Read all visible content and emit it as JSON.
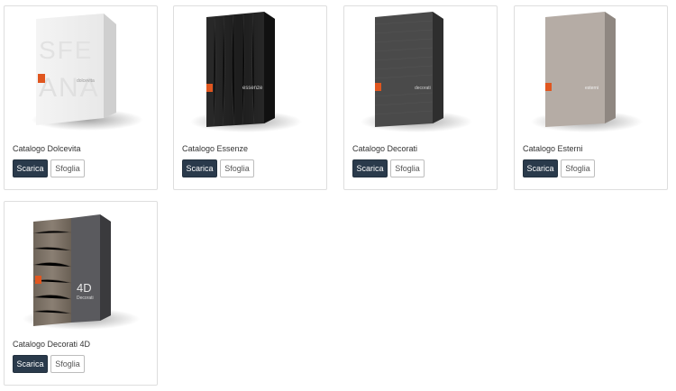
{
  "catalogs": [
    {
      "title": "Catalogo Dolcevita",
      "download_label": "Scarica",
      "browse_label": "Sfoglia",
      "cover_style": "white",
      "cover_text": "SFE ANA",
      "brand_mark": "dolcevita"
    },
    {
      "title": "Catalogo Essenze",
      "download_label": "Scarica",
      "browse_label": "Sfoglia",
      "cover_style": "dark-wood",
      "cover_text": "essenze",
      "brand_mark": "essenze"
    },
    {
      "title": "Catalogo Decorati",
      "download_label": "Scarica",
      "browse_label": "Sfoglia",
      "cover_style": "dark-grey",
      "cover_text": "decorati",
      "brand_mark": "decorati"
    },
    {
      "title": "Catalogo Esterni",
      "download_label": "Scarica",
      "browse_label": "Sfoglia",
      "cover_style": "taupe",
      "cover_text": "esterni",
      "brand_mark": "esterni"
    },
    {
      "title": "Catalogo Decorati 4D",
      "download_label": "Scarica",
      "browse_label": "Sfoglia",
      "cover_style": "wood-4d",
      "cover_text": "4D Decorati",
      "brand_mark": "4d"
    }
  ],
  "colors": {
    "primary_button": "#2a3a4b",
    "brand_orange": "#e0561f",
    "card_border": "#dedede"
  }
}
